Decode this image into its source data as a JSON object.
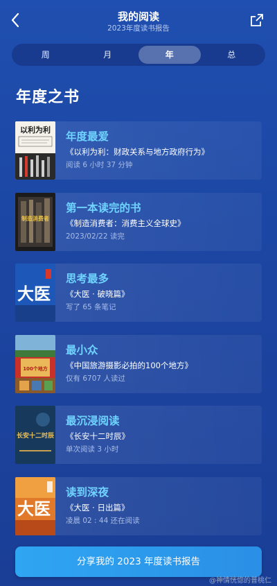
{
  "header": {
    "title": "我的阅读",
    "subtitle": "2023年度读书报告"
  },
  "tabs": [
    {
      "label": "周",
      "active": false
    },
    {
      "label": "月",
      "active": false
    },
    {
      "label": "年",
      "active": true
    },
    {
      "label": "总",
      "active": false
    }
  ],
  "section_title": "年度之书",
  "cards": [
    {
      "category": "年度最爱",
      "book": "《以利为利：财政关系与地方政府行为》",
      "stat": "阅读 6 小时 37 分钟",
      "cover_text": "以利为利"
    },
    {
      "category": "第一本读完的书",
      "book": "《制造消费者：消费主义全球史》",
      "stat": "2023/02/22 读完",
      "cover_text": "制造消费者"
    },
    {
      "category": "思考最多",
      "book": "《大医 · 破晓篇》",
      "stat": "写了 65 条笔记",
      "cover_text": "大医"
    },
    {
      "category": "最小众",
      "book": "《中国旅游摄影必拍的100个地方》",
      "stat": "仅有 6707 人读过",
      "cover_text": "100个地方"
    },
    {
      "category": "最沉浸阅读",
      "book": "《长安十二时辰》",
      "stat": "单次阅读 3 小时",
      "cover_text": "长安十二时辰"
    },
    {
      "category": "读到深夜",
      "book": "《大医 · 日出篇》",
      "stat": "凌晨 02 : 44 还在阅读",
      "cover_text": "大医"
    }
  ],
  "share_button": "分享我的 2023 年度读书报告",
  "watermark": "@神情恍惚的普桃仁"
}
